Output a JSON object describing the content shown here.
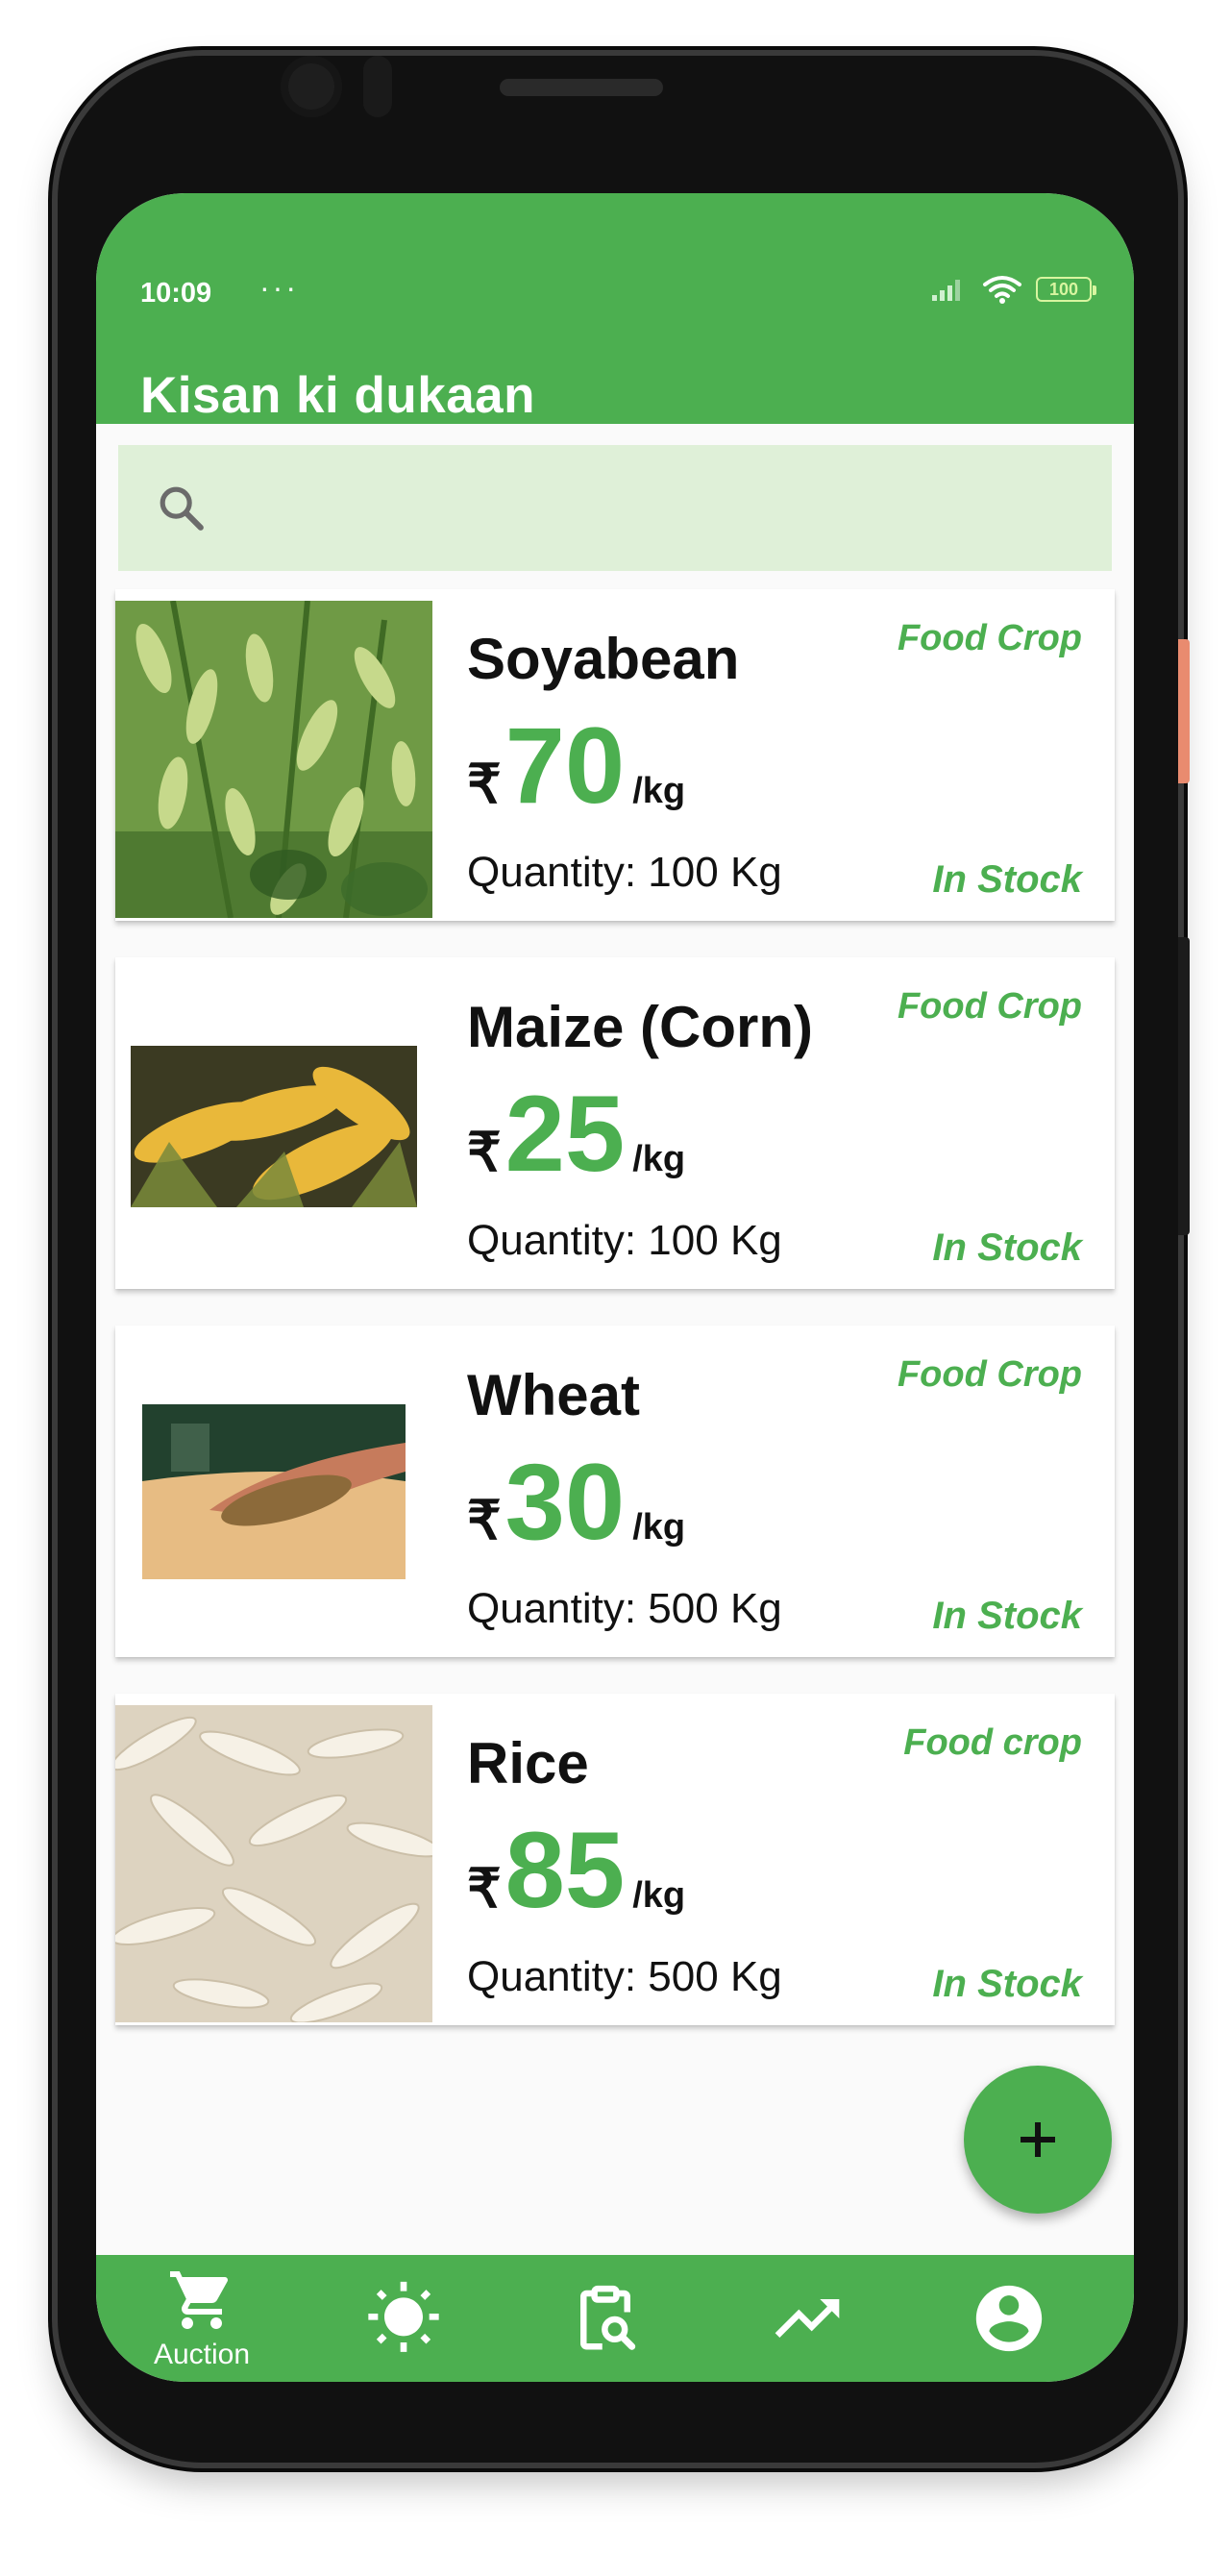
{
  "status_bar": {
    "time": "10:09",
    "dots": "···",
    "battery": "100"
  },
  "app_bar": {
    "title": "Kisan ki dukaan"
  },
  "search": {
    "placeholder": ""
  },
  "products": [
    {
      "name": "Soyabean",
      "category": "Food Crop",
      "currency": "₹",
      "price": "70",
      "unit": "/kg",
      "quantity": "Quantity: 100 Kg",
      "stock": "In Stock",
      "image": "soyabean-photo"
    },
    {
      "name": "Maize (Corn)",
      "category": "Food Crop",
      "currency": "₹",
      "price": "25",
      "unit": "/kg",
      "quantity": "Quantity: 100 Kg",
      "stock": "In Stock",
      "image": "corn-photo"
    },
    {
      "name": "Wheat",
      "category": "Food Crop",
      "currency": "₹",
      "price": "30",
      "unit": "/kg",
      "quantity": "Quantity: 500 Kg",
      "stock": "In Stock",
      "image": "wheat-photo"
    },
    {
      "name": "Rice",
      "category": "Food crop",
      "currency": "₹",
      "price": "85",
      "unit": "/kg",
      "quantity": "Quantity: 500 Kg",
      "stock": "In Stock",
      "image": "rice-photo"
    }
  ],
  "fab": {
    "icon": "plus-icon"
  },
  "bottom_nav": {
    "items": [
      {
        "icon": "cart-icon",
        "label": "Auction",
        "active": true
      },
      {
        "icon": "sun-icon",
        "label": ""
      },
      {
        "icon": "clipboard-search-icon",
        "label": ""
      },
      {
        "icon": "trending-up-icon",
        "label": ""
      },
      {
        "icon": "account-icon",
        "label": ""
      }
    ]
  },
  "colors": {
    "primary": "#4caf50",
    "search_bg": "#dff0d8",
    "text": "#111111"
  }
}
